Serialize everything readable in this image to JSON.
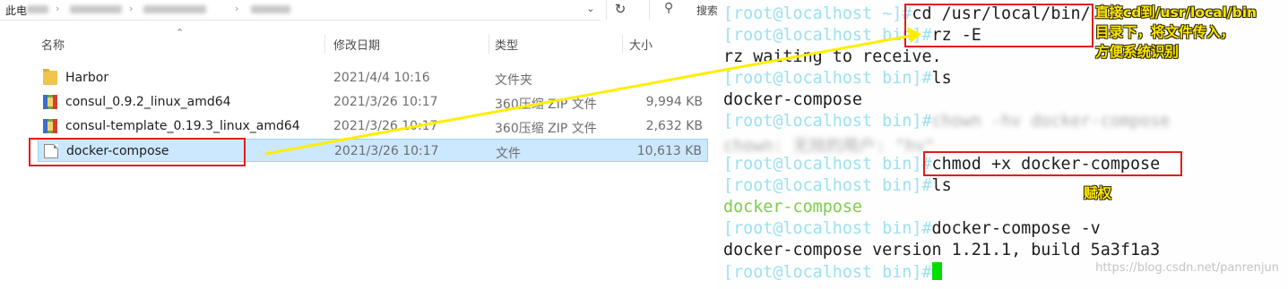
{
  "explorer": {
    "address": {
      "root_label": "此电",
      "dropdown_icon": "chevron-down-icon",
      "refresh_icon": "refresh-icon",
      "search_icon": "search-icon",
      "search_placeholder": "搜索"
    },
    "columns": {
      "name": "名称",
      "date": "修改日期",
      "type": "类型",
      "size": "大小"
    },
    "files": [
      {
        "name": "Harbor",
        "date": "2021/4/4 10:16",
        "type": "文件夹",
        "size": "",
        "icon": "folder-icon"
      },
      {
        "name": "consul_0.9.2_linux_amd64",
        "date": "2021/3/26 10:17",
        "type": "360压缩 ZIP 文件",
        "size": "9,994 KB",
        "icon": "zip-archive-icon"
      },
      {
        "name": "consul-template_0.19.3_linux_amd64",
        "date": "2021/3/26 10:17",
        "type": "360压缩 ZIP 文件",
        "size": "2,632 KB",
        "icon": "zip-archive-icon"
      },
      {
        "name": "docker-compose",
        "date": "2021/3/26 10:17",
        "type": "文件",
        "size": "10,613 KB",
        "icon": "file-icon",
        "selected": true
      }
    ]
  },
  "terminal": {
    "lines": [
      {
        "prompt": "[root@localhost ~]#",
        "cmd": "cd /usr/local/bin/"
      },
      {
        "prompt": "[root@localhost bin]#",
        "cmd": "rz -E"
      },
      {
        "text": "rz waiting to receive."
      },
      {
        "prompt": "[root@localhost bin]#",
        "cmd": "ls"
      },
      {
        "text": "docker-compose"
      },
      {
        "prompt": "[root@localhost bin]#",
        "cmd": "chown -hv docker-compose"
      },
      {
        "text": "chown: 无效的用户: \"hv\""
      },
      {
        "prompt": "[root@localhost bin]#",
        "cmd": "chmod +x docker-compose"
      },
      {
        "prompt": "[root@localhost bin]#",
        "cmd": "ls"
      },
      {
        "text": "docker-compose"
      },
      {
        "prompt": "[root@localhost bin]#",
        "cmd": "docker-compose -v"
      },
      {
        "text": "docker-compose version 1.21.1, build 5a3f1a3"
      },
      {
        "prompt": "[root@localhost bin]#",
        "cmd": ""
      }
    ]
  },
  "annotations": {
    "note_cd_lines": [
      "直接cd到/usr/local/bin",
      "目录下，将文件传入，",
      "方便系统识别"
    ],
    "note_chmod": "赋权"
  },
  "watermark": "https://blog.csdn.net/panrenjun",
  "colors": {
    "prompt": "#9be1f2",
    "terminal_text": "#1d1d1d",
    "executable": "#7ccd4a",
    "cursor": "#00e000",
    "highlight_box": "#e21c1c",
    "arrow": "#ffee00",
    "note": "#ffe600",
    "selection_bg": "#cce8ff"
  }
}
